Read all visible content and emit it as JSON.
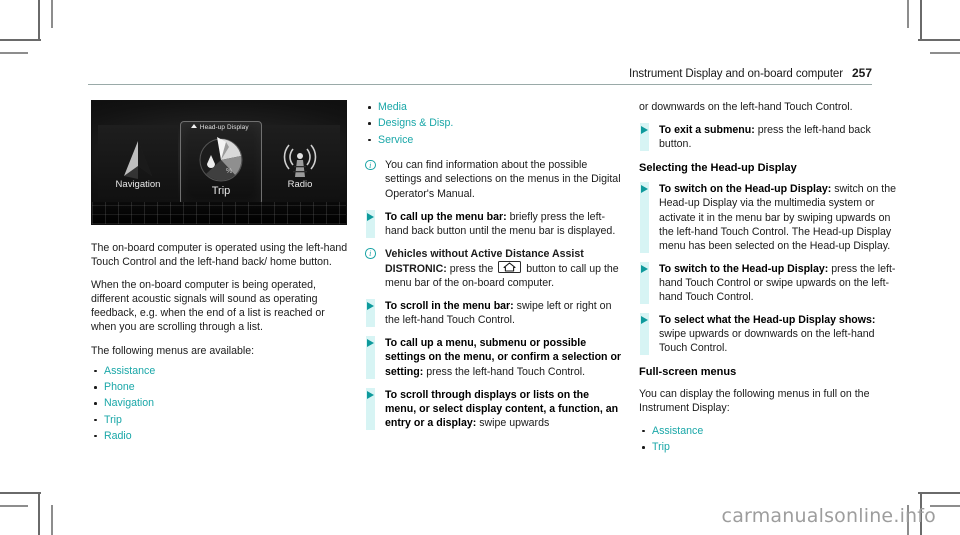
{
  "header": {
    "title": "Instrument Display and on-board computer",
    "page_number": "257"
  },
  "illustration": {
    "name": "infotainment-menu-bar",
    "hud_label": "Head-up Display",
    "tiles": [
      {
        "caption": "Navigation",
        "icon": "navigation-arrow-icon"
      },
      {
        "caption": "Trip",
        "icon": "trip-gauge-icon"
      },
      {
        "caption": "Radio",
        "icon": "radio-tower-icon"
      }
    ]
  },
  "column1": {
    "paragraphs": [
      "The on-board computer is operated using the left-hand Touch Control and the left-hand back/ home button.",
      "When the on-board computer is being operated, different acoustic signals will sound as operating feedback, e.g. when the end of a list is reached or when you are scrolling through a list.",
      "The following menus are available:"
    ],
    "menu_items": [
      "Assistance",
      "Phone",
      "Navigation",
      "Trip",
      "Radio"
    ]
  },
  "column2": {
    "menu_items_continued": [
      "Media",
      "Designs & Disp.",
      "Service"
    ],
    "note1": {
      "icon": "info-icon",
      "text": "You can find information about the possible settings and selections on the menus in the Digital Operator's Manual."
    },
    "action1": {
      "icon": "play-triangle-icon",
      "bold": "To call up the menu bar:",
      "rest": " briefly press the left-hand back button until the menu bar is displayed."
    },
    "note2": {
      "icon": "info-icon",
      "bold": "Vehicles without Active Distance Assist DISTRONIC:",
      "rest_before_key": " press the ",
      "key_icon": "home-icon",
      "rest_after_key": " button to call up the menu bar of the on-board computer."
    },
    "action2": {
      "icon": "play-triangle-icon",
      "bold": "To scroll in the menu bar:",
      "rest": " swipe left or right on the left-hand Touch Control."
    },
    "action3": {
      "icon": "play-triangle-icon",
      "bold": "To call up a menu, submenu or possible settings on the menu, or confirm a selection or setting:",
      "rest": " press the left-hand Touch Control."
    },
    "action4": {
      "icon": "play-triangle-icon",
      "bold": "To scroll through displays or lists on the menu, or select display content, a function, an entry or a display:",
      "rest": " swipe upwards"
    }
  },
  "column3": {
    "continuation": "or downwards on the left-hand Touch Control.",
    "action1": {
      "icon": "play-triangle-icon",
      "bold": "To exit a submenu:",
      "rest": " press the left-hand back button."
    },
    "heading1": "Selecting the Head-up Display",
    "action2": {
      "icon": "play-triangle-icon",
      "bold": "To switch on the Head-up Display:",
      "rest": " switch on the Head-up Display via the multimedia system or activate it in the menu bar by swiping upwards on the left-hand Touch Control. The Head-up Display menu has been selected on the Head-up Display."
    },
    "action3": {
      "icon": "play-triangle-icon",
      "bold": "To switch to the Head-up Display:",
      "rest": " press the left-hand Touch Control or swipe upwards on the left-hand Touch Control."
    },
    "action4": {
      "icon": "play-triangle-icon",
      "bold": "To select what the Head-up Display shows:",
      "rest": " swipe upwards or downwards on the left-hand Touch Control."
    },
    "heading2": "Full-screen menus",
    "paragraph": "You can display the following menus in full on the Instrument Display:",
    "menu_items": [
      "Assistance",
      "Trip"
    ]
  },
  "watermark": "carmanualsonline.info",
  "colors": {
    "teal_link": "#1aa7a8",
    "teal_marker": "#0e9a9c",
    "teal_bar": "#d7f4f4",
    "rule": "#9aaaa8",
    "text": "#1b1b1b",
    "watermark": "#9d9d9d"
  }
}
